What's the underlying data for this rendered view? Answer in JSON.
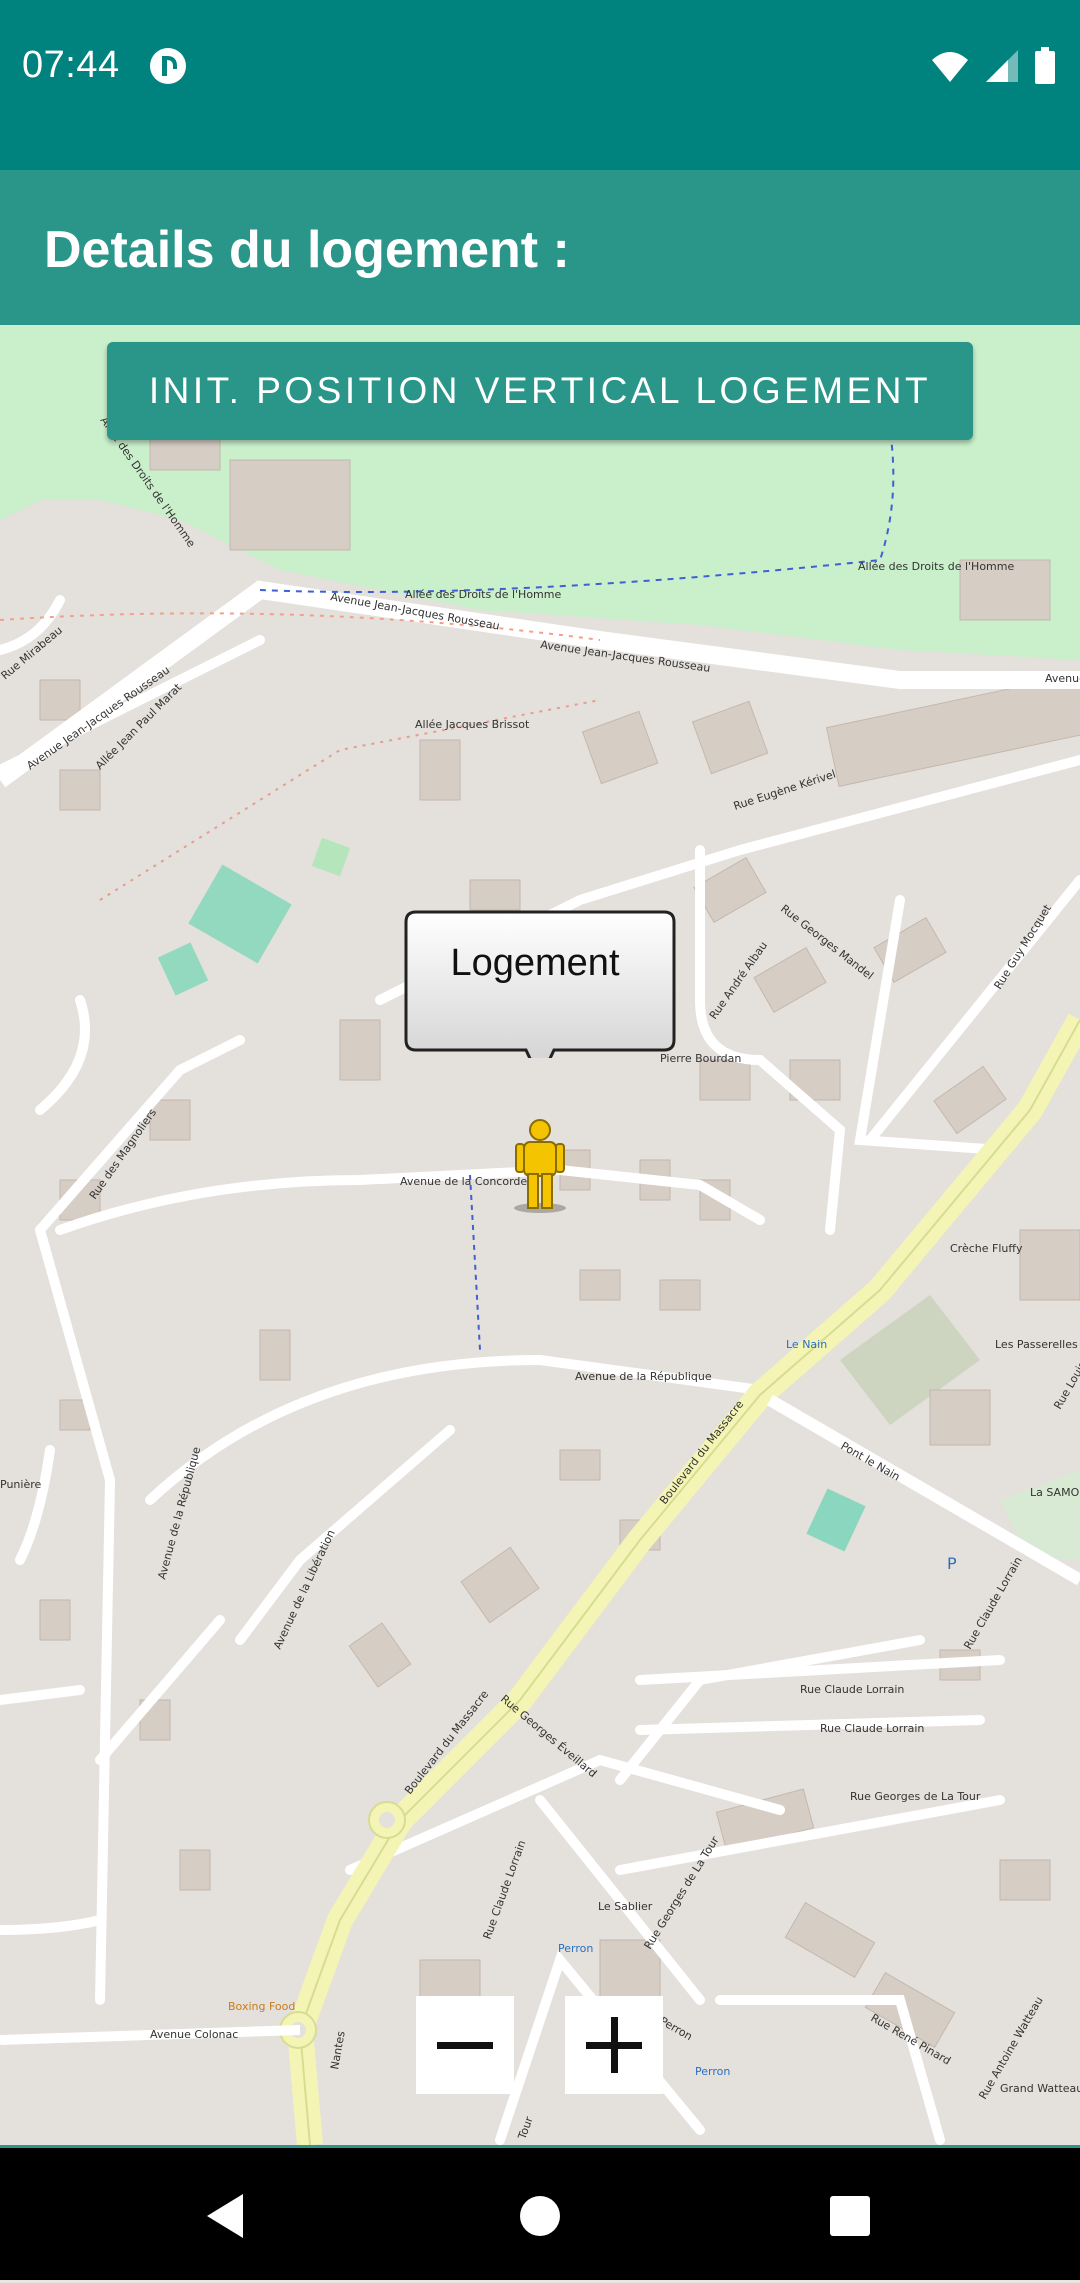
{
  "status": {
    "time": "07:44",
    "icons": [
      "wifi-icon",
      "signal-icon",
      "battery-icon"
    ]
  },
  "header": {
    "title": "Details du logement :"
  },
  "map": {
    "init_button_label": "INIT. POSITION VERTICAL LOGEMENT",
    "marker_callout": "Logement",
    "zoom_out_icon": "minus-icon",
    "zoom_in_icon": "plus-icon",
    "street_labels": [
      "Allée des Droits de l'Homme",
      "Allée des Droits de l'Homme",
      "Allée des Droits de l'Homme",
      "Avenue Jean-Jacques Rousseau",
      "Avenue Jean-Jacques Rousseau",
      "Avenue Jean-Jacques Rousseau",
      "Avenue",
      "Allée Jacques Brissot",
      "Allée Jean Paul Marat",
      "Rue Mirabeau",
      "Rue Eugène Kérivel",
      "Rue Georges Mandel",
      "Rue André Albau",
      "Rue Guy Mocquet",
      "Pierre Bourdan",
      "Avenue de la Concorde",
      "Rue des Magnoliers",
      "Avenue de la République",
      "Avenue de la République",
      "Avenue de la Libération",
      "Boulevard du Massacre",
      "Boulevard du Massacre",
      "Rue Georges Éveillard",
      "Rue Claude Lorrain",
      "Rue Claude Lorrain",
      "Rue Claude Lorrain",
      "Rue Claude Lorrain",
      "Rue Georges de La Tour",
      "Rue Georges de La Tour",
      "Rue René Pinard",
      "Rue Antoine Watteau",
      "Avenue Colonac",
      "Pont le Nain",
      "Les Passerelles du Vallon",
      "La SAMO",
      "Crèche Fluffy",
      "Le Nain",
      "Le Sablier",
      "Perron",
      "Perron",
      "Boxing Food",
      "Nantes",
      "Rue Louis",
      "Grand Watteau",
      "Punière",
      "Les Perron",
      "Tour",
      "P"
    ]
  },
  "nav": {
    "back_icon": "back-triangle-icon",
    "home_icon": "home-circle-icon",
    "recents_icon": "recents-square-icon"
  }
}
